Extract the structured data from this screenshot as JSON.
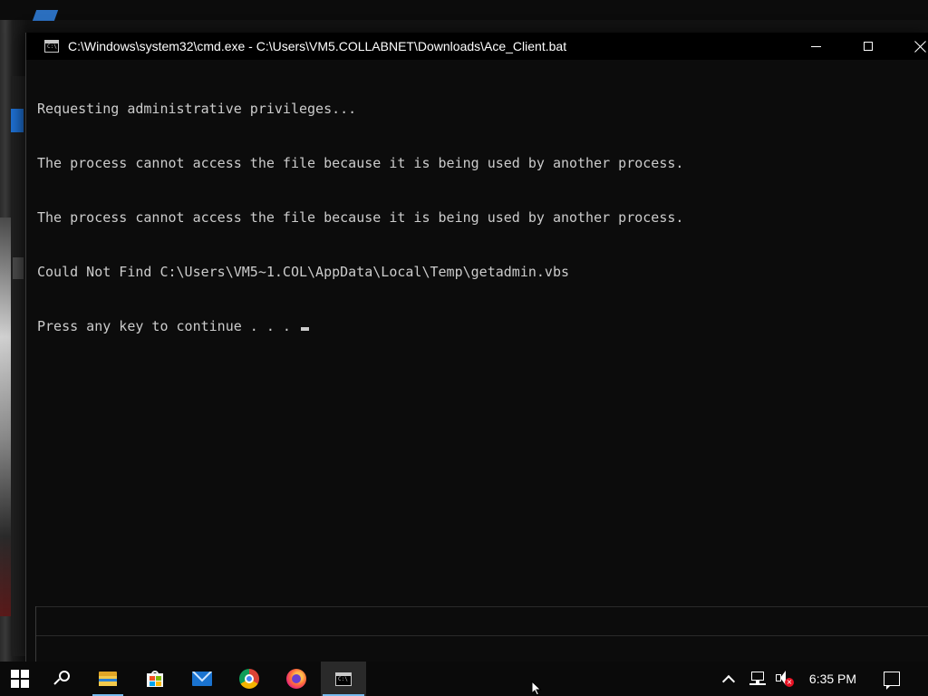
{
  "window": {
    "title": "C:\\Windows\\system32\\cmd.exe - C:\\Users\\VM5.COLLABNET\\Downloads\\Ace_Client.bat",
    "icon": "cmd-icon"
  },
  "console": {
    "lines": [
      "Requesting administrative privileges...",
      "The process cannot access the file because it is being used by another process.",
      "The process cannot access the file because it is being used by another process.",
      "Could Not Find C:\\Users\\VM5~1.COL\\AppData\\Local\\Temp\\getadmin.vbs",
      "Press any key to continue . . . "
    ],
    "text_color": "#cccccc",
    "background": "#0c0c0c"
  },
  "taskbar": {
    "items": [
      {
        "name": "start",
        "icon": "windows-logo-icon"
      },
      {
        "name": "search",
        "icon": "search-icon"
      },
      {
        "name": "file-explorer",
        "icon": "folder-icon",
        "running": true
      },
      {
        "name": "microsoft-store",
        "icon": "store-icon"
      },
      {
        "name": "mail",
        "icon": "mail-icon"
      },
      {
        "name": "chrome",
        "icon": "chrome-icon"
      },
      {
        "name": "firefox",
        "icon": "firefox-icon"
      },
      {
        "name": "command-prompt",
        "icon": "cmd-icon",
        "running": true,
        "active": true
      }
    ],
    "tray": {
      "clock": "6:35 PM",
      "icons": [
        "chevron-up-icon",
        "network-icon",
        "volume-muted-icon",
        "notifications-icon"
      ]
    },
    "accent": "#76b9ed"
  }
}
